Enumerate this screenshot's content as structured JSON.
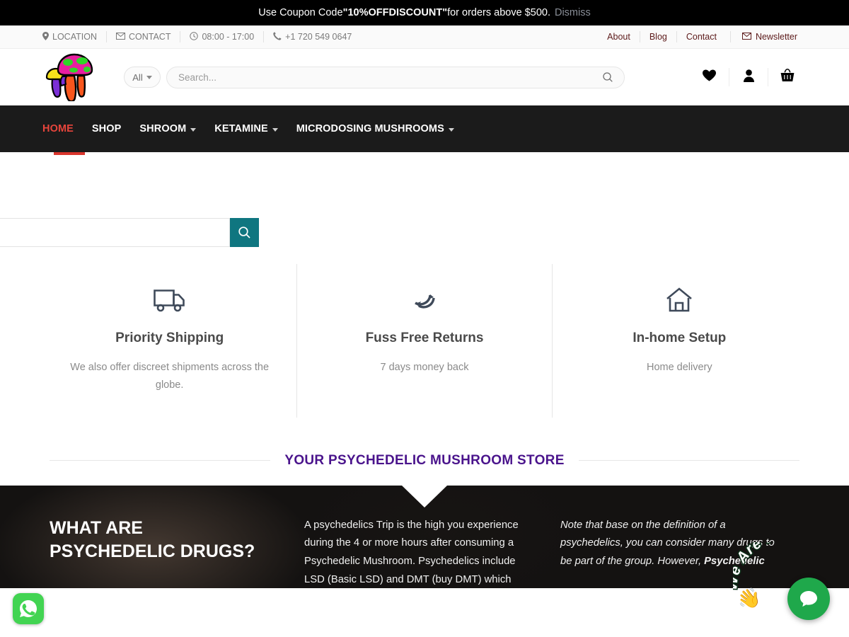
{
  "coupon": {
    "prefix": "Use Coupon Code ",
    "code": "\"10%OFFDISCOUNT\"",
    "suffix": " for orders above $500.",
    "dismiss": "Dismiss",
    "bg": "#000000"
  },
  "topbar": {
    "left": [
      {
        "icon": "map-pin-icon",
        "glyph": "⚑",
        "label": "LOCATION"
      },
      {
        "icon": "envelope-icon",
        "glyph": "✉",
        "label": "CONTACT"
      },
      {
        "icon": "clock-icon",
        "glyph": "◴",
        "label": "08:00 - 17:00"
      },
      {
        "icon": "phone-icon",
        "glyph": "☎",
        "label": "+1 720 549 0647"
      }
    ],
    "right": [
      {
        "label": "About"
      },
      {
        "label": "Blog"
      },
      {
        "label": "Contact"
      }
    ],
    "newsletter": {
      "icon": "envelope-icon",
      "glyph": "✉",
      "label": "Newsletter"
    },
    "link_color": "#5c1a1a"
  },
  "header": {
    "logo_name": "psychedelic-mushroom-logo",
    "category_select": {
      "value": "All"
    },
    "search": {
      "value": "",
      "placeholder": "Search..."
    },
    "icons": [
      {
        "name": "wishlist-heart-icon",
        "label": "Wishlist"
      },
      {
        "name": "account-person-icon",
        "label": "Account"
      },
      {
        "name": "cart-basket-icon",
        "label": "Cart"
      }
    ]
  },
  "nav": {
    "items": [
      {
        "label": "HOME",
        "active": true,
        "has_dropdown": false
      },
      {
        "label": "SHOP",
        "active": false,
        "has_dropdown": false
      },
      {
        "label": "SHROOM",
        "active": false,
        "has_dropdown": true
      },
      {
        "label": "KETAMINE",
        "active": false,
        "has_dropdown": true
      },
      {
        "label": "MICRODOSING MUSHROOMS",
        "active": false,
        "has_dropdown": true
      }
    ],
    "bg": "#1b1b1b",
    "active_color": "#e8453c"
  },
  "offscreen_search_widget": {
    "input_value": "",
    "submit_name": "search-submit-button",
    "button_color": "#0f7680"
  },
  "features": [
    {
      "icon": "delivery-truck-icon",
      "title": "Priority Shipping",
      "desc": "We also offer discreet shipments across the globe."
    },
    {
      "icon": "refresh-returns-icon",
      "title": "Fuss Free Returns",
      "desc": "7 days money back"
    },
    {
      "icon": "home-house-icon",
      "title": "In-home Setup",
      "desc": "Home delivery"
    }
  ],
  "section": {
    "title": "YOUR PSYCHEDELIC MUSHROOM STORE",
    "title_color": "#4a148c"
  },
  "hero": {
    "heading": "WHAT ARE PSYCHEDELIC DRUGS?",
    "column_center": "A psychedelics Trip is the high you experience during the 4 or more hours after consuming a Psychedelic Mushroom. Psychedelics include LSD (Basic LSD) and DMT (buy DMT) which",
    "column_right_pre": "Note that base on the definition of a psychedelics, you can consider many drugs to be part of the group. However, ",
    "column_right_bold": "Psychedelic"
  },
  "floating": {
    "whatsapp": {
      "name": "whatsapp-button",
      "color": "#42d452"
    },
    "chat": {
      "name": "chat-bubble-button",
      "color": "#1fa84b",
      "badge_text": "We Are Here!",
      "hand": "👋"
    }
  }
}
